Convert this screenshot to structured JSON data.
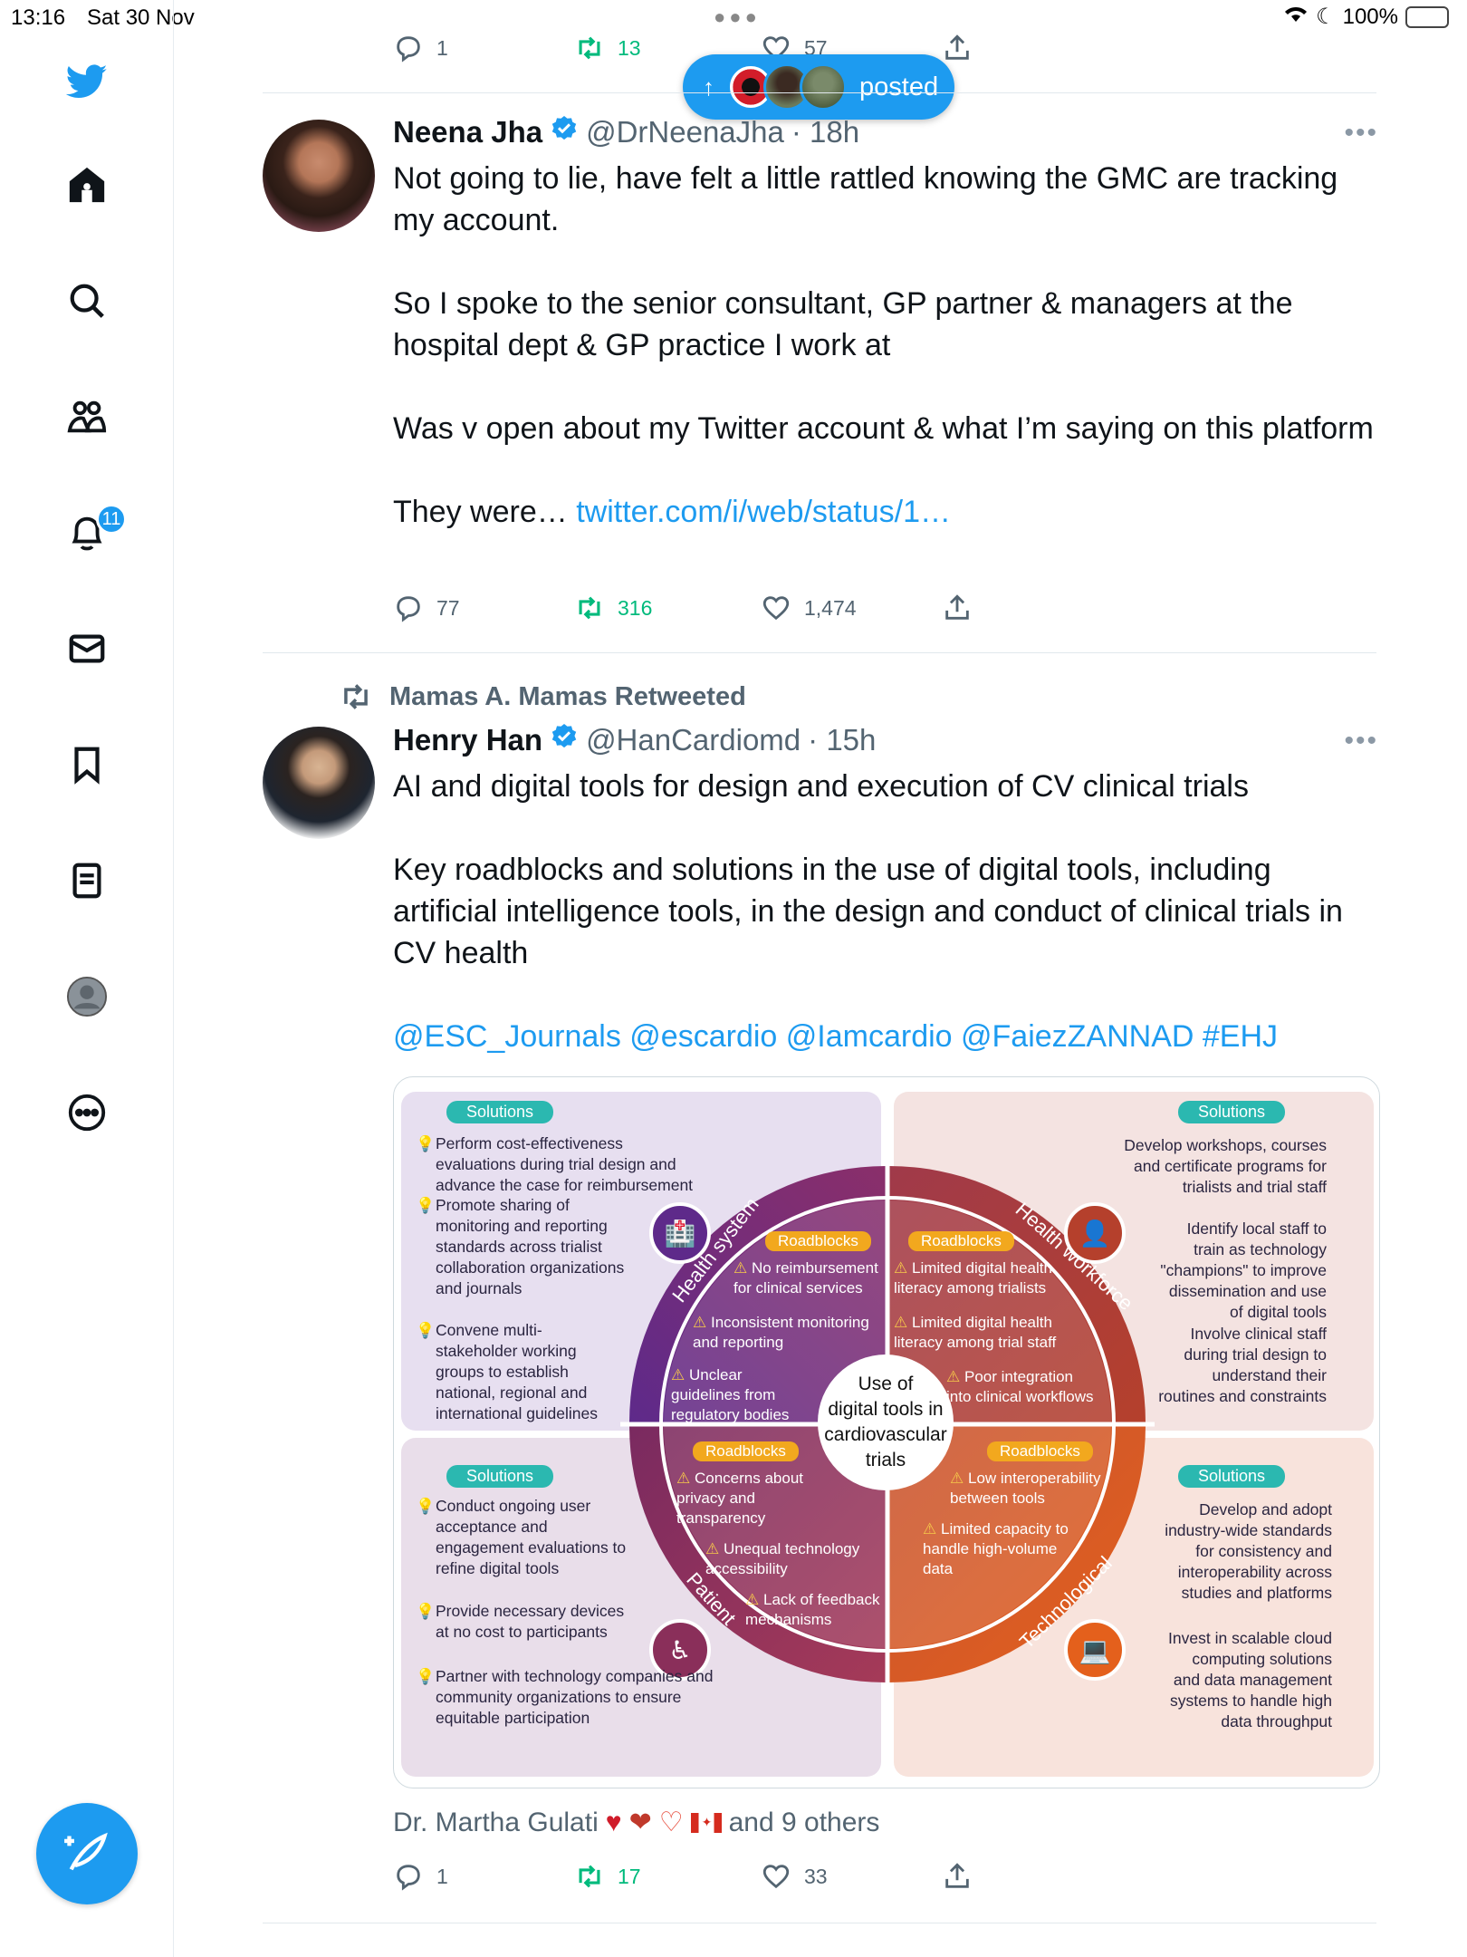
{
  "status_bar": {
    "time": "13:16",
    "date": "Sat 30 Nov",
    "battery": "100%"
  },
  "sidebar": {
    "notifications_badge": "11",
    "items": [
      "twitter-logo",
      "home",
      "search",
      "communities",
      "notifications",
      "messages",
      "bookmarks",
      "lists",
      "profile",
      "more"
    ]
  },
  "top_actions": {
    "replies": "1",
    "retweets": "13",
    "likes": "57"
  },
  "new_posts_pill": {
    "label": "posted"
  },
  "tweet1": {
    "name": "Neena Jha",
    "handle": "@DrNeenaJha",
    "time": "· 18h",
    "paragraphs": [
      "Not going to lie, have felt a little rattled knowing the GMC are tracking my account.",
      "So I spoke to the senior consultant, GP partner & managers at the hospital dept & GP practice I work at",
      "Was v open about my Twitter account & what I’m saying on this platform"
    ],
    "last_text": "They were… ",
    "link": "twitter.com/i/web/status/1…",
    "replies": "77",
    "retweets": "316",
    "likes": "1,474"
  },
  "retweet_context": {
    "label": "Mamas A. Mamas Retweeted"
  },
  "tweet2": {
    "name": "Henry Han",
    "handle": "@HanCardiomd",
    "time": "· 15h",
    "paragraphs": [
      "AI and digital tools for design and execution of CV clinical trials",
      "Key roadblocks and solutions in the use of digital tools, including artificial intelligence tools, in the design and conduct of clinical trials in CV health"
    ],
    "mentions": "@ESC_Journals @escardio @Iamcardio @FaiezZANNAD #EHJ",
    "liked_by": "Dr. Martha Gulati",
    "liked_others": "and 9 others",
    "replies": "1",
    "retweets": "17",
    "likes": "33"
  },
  "infographic": {
    "center": [
      "Use of",
      "digital tools in",
      "cardiovascular",
      "trials"
    ],
    "solutions_label": "Solutions",
    "roadblocks_label": "Roadblocks",
    "sections": {
      "health_system": "Health system",
      "health_workforce": "Health workforce",
      "patient": "Patient",
      "technological": "Technological"
    },
    "tl_solutions": [
      "Perform cost-effectiveness evaluations during trial design and advance the case for reimbursement",
      "Promote sharing of monitoring and reporting standards across trialist collaboration organizations and journals",
      "Convene multi-stakeholder working groups to establish national, regional and international guidelines"
    ],
    "tl_roadblocks": [
      "No reimbursement for clinical services",
      "Inconsistent monitoring and reporting",
      "Unclear guidelines from regulatory bodies"
    ],
    "tr_solutions": [
      "Develop workshops, courses and certificate programs for trialists and trial staff",
      "Identify local staff to train as technology \"champions\" to improve dissemination and use of digital tools",
      "Involve clinical staff during trial design to understand their routines and constraints"
    ],
    "tr_roadblocks": [
      "Limited digital health literacy among trialists",
      "Limited digital health literacy among trial staff",
      "Poor integration into clinical workflows"
    ],
    "bl_solutions": [
      "Conduct ongoing user acceptance and engagement evaluations to refine digital tools",
      "Provide necessary devices at no cost to participants",
      "Partner with technology companies and community organizations to ensure equitable participation"
    ],
    "bl_roadblocks": [
      "Concerns about privacy and transparency",
      "Unequal technology accessibility",
      "Lack of feedback mechanisms"
    ],
    "br_solutions": [
      "Develop and adopt industry-wide standards for consistency and interoperability across studies and platforms",
      "Invest in scalable cloud computing solutions and data management systems to handle high data throughput"
    ],
    "br_roadblocks": [
      "Low interoperability between tools",
      "Limited capacity to handle high-volume data"
    ]
  },
  "colors": {
    "accent": "#1d9bf0",
    "retweet": "#00ba7c",
    "muted": "#536471"
  }
}
